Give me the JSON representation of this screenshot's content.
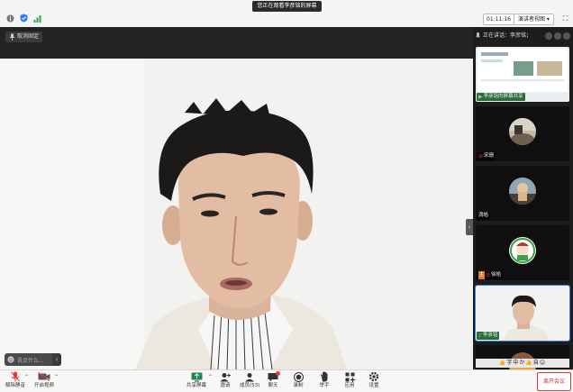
{
  "top": {
    "share_banner": "您正在观看李彦铭的屏幕",
    "timer": "01:11:16",
    "view_button": "演讲者视图 ▾",
    "fullscreen_glyph": "⛶"
  },
  "stage": {
    "label": "取消固定",
    "chat_placeholder": "说点什么...",
    "chat_collapse": "‹",
    "panel_collapse": "›"
  },
  "sidebar": {
    "speaking": "正在讲话：李彦铭；",
    "tiles": [
      {
        "name": "李彦铭的屏幕共享",
        "kind": "share"
      },
      {
        "name": "宋珊",
        "kind": "avatar"
      },
      {
        "name": "満皓",
        "kind": "avatar"
      },
      {
        "name": "徐皓",
        "kind": "avatar"
      },
      {
        "name": "李彦铭",
        "kind": "video"
      },
      {
        "name": "",
        "kind": "avatar"
      }
    ],
    "reactions": "👍字中か👍自☺"
  },
  "bottom": {
    "items": [
      {
        "label": "解除静音",
        "icon": "mic-muted-icon"
      },
      {
        "label": "开启视频",
        "icon": "camera-off-icon"
      },
      {
        "label": "共享屏幕",
        "icon": "screen-share-icon"
      },
      {
        "label": "邀请",
        "icon": "invite-icon"
      },
      {
        "label": "成员(53)",
        "icon": "members-icon"
      },
      {
        "label": "聊天",
        "icon": "chat-icon"
      },
      {
        "label": "录制",
        "icon": "record-icon"
      },
      {
        "label": "举手",
        "icon": "raise-hand-icon"
      },
      {
        "label": "应用",
        "icon": "apps-icon"
      },
      {
        "label": "设置",
        "icon": "settings-icon"
      }
    ],
    "leave": "离开会议"
  },
  "colors": {
    "accent": "#2f7ee8",
    "leave_red": "#d33333",
    "mic_red": "#e53935"
  }
}
